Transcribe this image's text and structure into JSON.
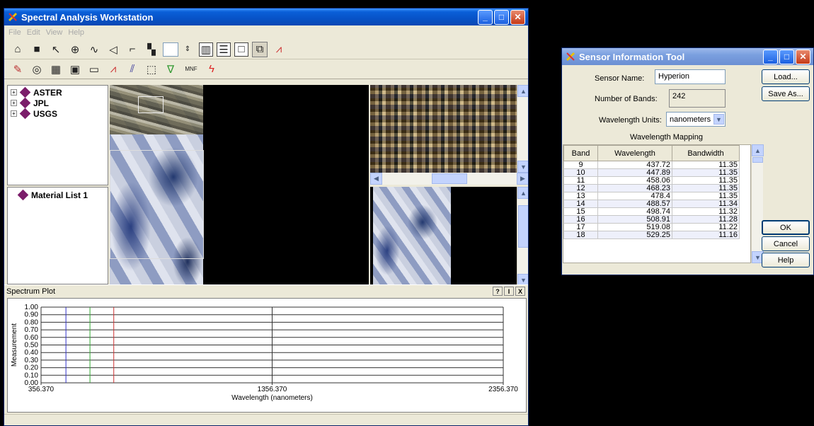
{
  "main_window": {
    "title": "Spectral Analysis Workstation",
    "menu": [
      "File",
      "Edit",
      "View",
      "Help"
    ],
    "tree": {
      "libraries": [
        {
          "label": "ASTER"
        },
        {
          "label": "JPL"
        },
        {
          "label": "USGS"
        }
      ],
      "material_list": "Material List 1"
    },
    "toolbar_buttons": [
      "open-icon",
      "save-icon",
      "arrow-icon",
      "crosshair-icon",
      "curve-icon",
      "polygon-icon",
      "freehand-icon",
      "lock-icon"
    ],
    "second_toolbar_label": "MNF"
  },
  "spectrum_plot": {
    "header": "Spectrum Plot",
    "help": "?",
    "pin": "I",
    "close": "X"
  },
  "chart_data": {
    "type": "line",
    "xlabel": "Wavelength (nanometers)",
    "ylabel": "Measurement",
    "ylim": [
      0,
      1
    ],
    "yticks": [
      "1.00",
      "0.90",
      "0.80",
      "0.70",
      "0.60",
      "0.50",
      "0.40",
      "0.30",
      "0.20",
      "0.10",
      "0.00"
    ],
    "xticks": [
      "356.370",
      "1356.370",
      "2356.370"
    ],
    "xlim": [
      356.37,
      2356.37
    ],
    "markers": [
      {
        "color": "#3333cc",
        "x": 464
      },
      {
        "color": "#33aa33",
        "x": 568
      },
      {
        "color": "#cc3333",
        "x": 671
      }
    ],
    "series": []
  },
  "sensor_tool": {
    "title": "Sensor Information Tool",
    "sensor_name_label": "Sensor Name:",
    "sensor_name": "Hyperion",
    "bands_label": "Number of Bands:",
    "bands": "242",
    "units_label": "Wavelength Units:",
    "units": "nanometers",
    "mapping_title": "Wavelength Mapping",
    "columns": [
      "Band",
      "Wavelength",
      "Bandwidth"
    ],
    "rows": [
      [
        "9",
        "437.72",
        "11.35"
      ],
      [
        "10",
        "447.89",
        "11.35"
      ],
      [
        "11",
        "458.06",
        "11.35"
      ],
      [
        "12",
        "468.23",
        "11.35"
      ],
      [
        "13",
        "478.4",
        "11.35"
      ],
      [
        "14",
        "488.57",
        "11.34"
      ],
      [
        "15",
        "498.74",
        "11.32"
      ],
      [
        "16",
        "508.91",
        "11.28"
      ],
      [
        "17",
        "519.08",
        "11.22"
      ],
      [
        "18",
        "529.25",
        "11.16"
      ]
    ],
    "buttons": {
      "load": "Load...",
      "save_as": "Save As...",
      "ok": "OK",
      "cancel": "Cancel",
      "help": "Help"
    }
  }
}
